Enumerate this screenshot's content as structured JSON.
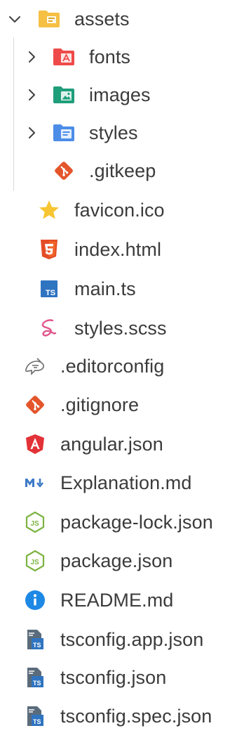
{
  "explorer": {
    "folders": {
      "assets": "assets",
      "fonts": "fonts",
      "images": "images",
      "styles": "styles"
    },
    "files": {
      "gitkeep": ".gitkeep",
      "favicon": "favicon.ico",
      "index": "index.html",
      "main": "main.ts",
      "styles_scss": "styles.scss",
      "editorconfig": ".editorconfig",
      "gitignore": ".gitignore",
      "angular": "angular.json",
      "explanation": "Explanation.md",
      "package_lock": "package-lock.json",
      "package": "package.json",
      "readme": "README.md",
      "tsconfig_app": "tsconfig.app.json",
      "tsconfig": "tsconfig.json",
      "tsconfig_spec": "tsconfig.spec.json"
    }
  },
  "icons": {
    "chevron_open": "chevron-down-icon",
    "chevron_closed": "chevron-right-icon",
    "assets": "folder-assets-icon",
    "fonts": "folder-fonts-icon",
    "images": "folder-images-icon",
    "styles": "folder-styles-icon",
    "git": "git-icon",
    "favicon": "star-icon",
    "html": "html5-icon",
    "typescript": "typescript-icon",
    "sass": "sass-icon",
    "editorconfig": "editorconfig-icon",
    "angular": "angular-icon",
    "markdown": "markdown-icon",
    "nodejs": "nodejs-icon",
    "info": "info-icon",
    "tsconfig": "tsconfig-icon"
  },
  "colors": {
    "text": "#3b3b3b",
    "folder_assets": "#F5C044",
    "folder_fonts": "#EF4A4A",
    "folder_images": "#1F9E7A",
    "folder_styles": "#4C8DE8",
    "git": "#E4552B",
    "star": "#F7C531",
    "html": "#E44D26",
    "typescript": "#2F74C0",
    "sass": "#E0558B",
    "angular": "#E23237",
    "markdown": "#3D7AC7",
    "nodejs": "#7CB342",
    "info": "#1E88E5",
    "tsconfig": "#2F74C0",
    "guide": "#d9d9d9"
  }
}
